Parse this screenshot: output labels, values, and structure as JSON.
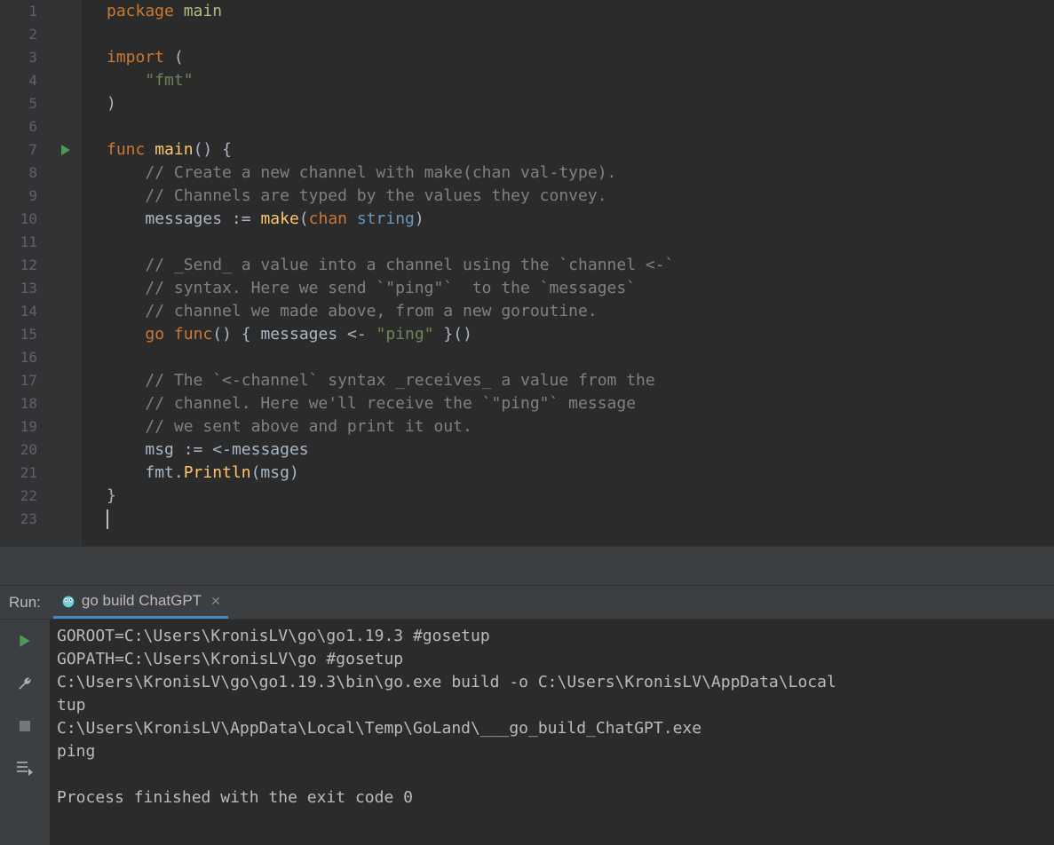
{
  "editor": {
    "lines": [
      {
        "n": 1,
        "tokens": [
          [
            "kw",
            "package"
          ],
          [
            "sp",
            " "
          ],
          [
            "pkg-name",
            "main"
          ]
        ]
      },
      {
        "n": 2,
        "tokens": []
      },
      {
        "n": 3,
        "tokens": [
          [
            "kw",
            "import"
          ],
          [
            "sp",
            " "
          ],
          [
            "paren",
            "("
          ]
        ]
      },
      {
        "n": 4,
        "tokens": [
          [
            "sp",
            "    "
          ],
          [
            "str",
            "\"fmt\""
          ]
        ]
      },
      {
        "n": 5,
        "tokens": [
          [
            "paren",
            ")"
          ]
        ]
      },
      {
        "n": 6,
        "tokens": []
      },
      {
        "n": 7,
        "run": true,
        "tokens": [
          [
            "kw",
            "func"
          ],
          [
            "sp",
            " "
          ],
          [
            "func-name",
            "main"
          ],
          [
            "paren",
            "()"
          ],
          [
            "sp",
            " "
          ],
          [
            "paren",
            "{"
          ]
        ]
      },
      {
        "n": 8,
        "tokens": [
          [
            "sp",
            "    "
          ],
          [
            "comment",
            "// Create a new channel with make(chan val-type)."
          ]
        ]
      },
      {
        "n": 9,
        "tokens": [
          [
            "sp",
            "    "
          ],
          [
            "comment",
            "// Channels are typed by the values they convey."
          ]
        ]
      },
      {
        "n": 10,
        "tokens": [
          [
            "sp",
            "    "
          ],
          [
            "ident",
            "messages "
          ],
          [
            "op",
            ":="
          ],
          [
            "sp",
            " "
          ],
          [
            "builtin",
            "make"
          ],
          [
            "paren",
            "("
          ],
          [
            "kw",
            "chan"
          ],
          [
            "sp",
            " "
          ],
          [
            "type",
            "string"
          ],
          [
            "paren",
            ")"
          ]
        ]
      },
      {
        "n": 11,
        "tokens": []
      },
      {
        "n": 12,
        "tokens": [
          [
            "sp",
            "    "
          ],
          [
            "comment",
            "// _Send_ a value into a channel using the `channel <-`"
          ]
        ]
      },
      {
        "n": 13,
        "tokens": [
          [
            "sp",
            "    "
          ],
          [
            "comment",
            "// syntax. Here we send `\"ping\"`  to the `messages`"
          ]
        ]
      },
      {
        "n": 14,
        "tokens": [
          [
            "sp",
            "    "
          ],
          [
            "comment",
            "// channel we made above, from a new goroutine."
          ]
        ]
      },
      {
        "n": 15,
        "tokens": [
          [
            "sp",
            "    "
          ],
          [
            "kw",
            "go"
          ],
          [
            "sp",
            " "
          ],
          [
            "kw",
            "func"
          ],
          [
            "paren",
            "()"
          ],
          [
            "sp",
            " "
          ],
          [
            "paren",
            "{"
          ],
          [
            "sp",
            " "
          ],
          [
            "ident",
            "messages "
          ],
          [
            "op",
            "<-"
          ],
          [
            "sp",
            " "
          ],
          [
            "str",
            "\"ping\""
          ],
          [
            "sp",
            " "
          ],
          [
            "paren",
            "}"
          ],
          [
            "paren",
            "()"
          ]
        ]
      },
      {
        "n": 16,
        "tokens": []
      },
      {
        "n": 17,
        "tokens": [
          [
            "sp",
            "    "
          ],
          [
            "comment",
            "// The `<-channel` syntax _receives_ a value from the"
          ]
        ]
      },
      {
        "n": 18,
        "tokens": [
          [
            "sp",
            "    "
          ],
          [
            "comment",
            "// channel. Here we'll receive the `\"ping\"` message"
          ]
        ]
      },
      {
        "n": 19,
        "tokens": [
          [
            "sp",
            "    "
          ],
          [
            "comment",
            "// we sent above and print it out."
          ]
        ]
      },
      {
        "n": 20,
        "tokens": [
          [
            "sp",
            "    "
          ],
          [
            "ident",
            "msg "
          ],
          [
            "op",
            ":="
          ],
          [
            "sp",
            " "
          ],
          [
            "op",
            "<-"
          ],
          [
            "ident",
            "messages"
          ]
        ]
      },
      {
        "n": 21,
        "tokens": [
          [
            "sp",
            "    "
          ],
          [
            "ident",
            "fmt"
          ],
          [
            "op",
            "."
          ],
          [
            "func-name",
            "Println"
          ],
          [
            "paren",
            "("
          ],
          [
            "ident",
            "msg"
          ],
          [
            "paren",
            ")"
          ]
        ]
      },
      {
        "n": 22,
        "tokens": [
          [
            "paren",
            "}"
          ]
        ]
      },
      {
        "n": 23,
        "caret": true,
        "tokens": []
      }
    ]
  },
  "run_panel": {
    "label": "Run:",
    "tab_name": "go build ChatGPT",
    "console_lines": [
      "GOROOT=C:\\Users\\KronisLV\\go\\go1.19.3 #gosetup",
      "GOPATH=C:\\Users\\KronisLV\\go #gosetup",
      "C:\\Users\\KronisLV\\go\\go1.19.3\\bin\\go.exe build -o C:\\Users\\KronisLV\\AppData\\Local",
      "tup",
      "C:\\Users\\KronisLV\\AppData\\Local\\Temp\\GoLand\\___go_build_ChatGPT.exe",
      "ping",
      "",
      "Process finished with the exit code 0"
    ]
  }
}
